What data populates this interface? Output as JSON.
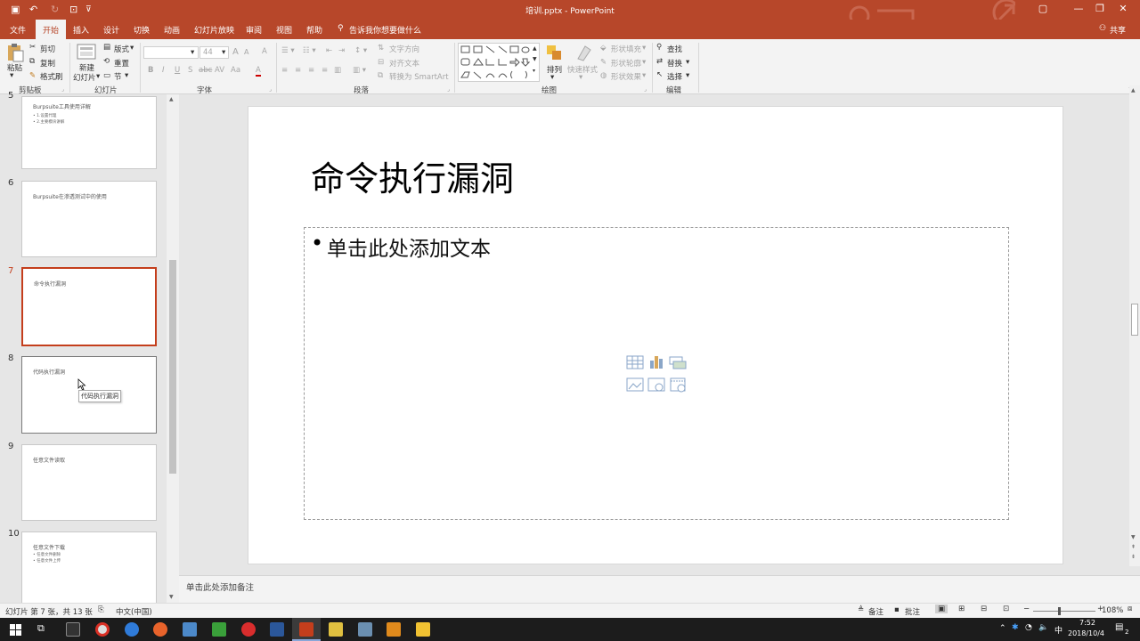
{
  "titlebar": {
    "title": "培训.pptx  -  PowerPoint",
    "minimize": "—",
    "restore": "❐",
    "close": "✕",
    "ribbon_display": "▢"
  },
  "quick_access": {
    "save": "▣",
    "undo": "↶",
    "redo": "↻",
    "customize": "⊽"
  },
  "tabs": [
    "文件",
    "开始",
    "插入",
    "设计",
    "切换",
    "动画",
    "幻灯片放映",
    "审阅",
    "视图",
    "帮助"
  ],
  "active_tab": "开始",
  "tell_me": "告诉我你想要做什么",
  "share": "共享",
  "ribbon": {
    "clipboard": {
      "paste": "粘贴",
      "cut": "剪切",
      "copy": "复制",
      "format_painter": "格式刷",
      "label": "剪贴板"
    },
    "slides": {
      "new_slide": "新建",
      "new_slide2": "幻灯片",
      "layout": "版式",
      "reset": "重置",
      "section": "节",
      "label": "幻灯片"
    },
    "font": {
      "font_name": "",
      "font_size": "44",
      "bold": "B",
      "italic": "I",
      "underline": "U",
      "shadow": "S",
      "strike": "abc",
      "spacing": "AV",
      "case": "Aa",
      "grow": "A",
      "shrink": "A",
      "clear": "A",
      "color": "A",
      "label": "字体"
    },
    "paragraph": {
      "text_direction": "文字方向",
      "align_text": "对齐文本",
      "smartart": "转换为 SmartArt",
      "label": "段落"
    },
    "drawing": {
      "arrange": "排列",
      "quick_styles": "快速样式",
      "fill": "形状填充",
      "outline": "形状轮廓",
      "effects": "形状效果",
      "label": "绘图"
    },
    "editing": {
      "find": "查找",
      "replace": "替换",
      "select": "选择",
      "label": "编辑"
    }
  },
  "slides": [
    {
      "num": "5",
      "title": "Burpsuite工具使用详解",
      "bullets": [
        "• 1.设置代理",
        "• 2.主要模块讲解"
      ]
    },
    {
      "num": "6",
      "title": "Burpsuite在渗透测试中的使用",
      "bullets": []
    },
    {
      "num": "7",
      "title": "命令执行漏洞",
      "bullets": []
    },
    {
      "num": "8",
      "title": "代码执行漏洞",
      "bullets": []
    },
    {
      "num": "9",
      "title": "任意文件读取",
      "bullets": []
    },
    {
      "num": "10",
      "title": "任意文件下载",
      "bullets": [
        "• 任意文件删除",
        "• 任意文件上传"
      ]
    }
  ],
  "tooltip": "代码执行漏洞",
  "main_slide": {
    "title": "命令执行漏洞",
    "body_placeholder": "单击此处添加文本"
  },
  "notes_placeholder": "单击此处添加备注",
  "status": {
    "slide_info": "幻灯片 第 7 张，共 13 张",
    "language": "中文(中国)",
    "notes": "备注",
    "comments": "批注",
    "zoom": "108%"
  },
  "taskbar": {
    "time": "7:52",
    "date": "2018/10/4",
    "ime": "中",
    "notif": "2"
  }
}
